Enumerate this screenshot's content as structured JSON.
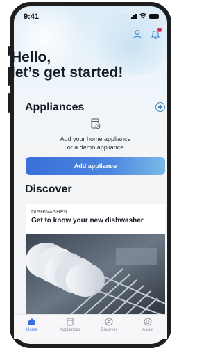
{
  "status": {
    "time": "9:41"
  },
  "header": {
    "greeting_line1": "Hello,",
    "greeting_line2": "let’s get started!"
  },
  "appliances": {
    "title": "Appliances",
    "empty_line1": "Add your home appliance",
    "empty_line2": "or a demo appliance",
    "add_button": "Add appliance"
  },
  "discover": {
    "title": "Discover",
    "card": {
      "tag": "DISHWASHER",
      "title": "Get to know your new dishwasher"
    }
  },
  "tabs": [
    {
      "label": "Home",
      "icon": "home-icon",
      "active": true
    },
    {
      "label": "Appliances",
      "icon": "appliance-icon"
    },
    {
      "label": "Discover",
      "icon": "compass-icon"
    },
    {
      "label": "Assist",
      "icon": "smiley-icon"
    }
  ],
  "colors": {
    "accent": "#3a6fd8",
    "notification": "#e0284a"
  }
}
